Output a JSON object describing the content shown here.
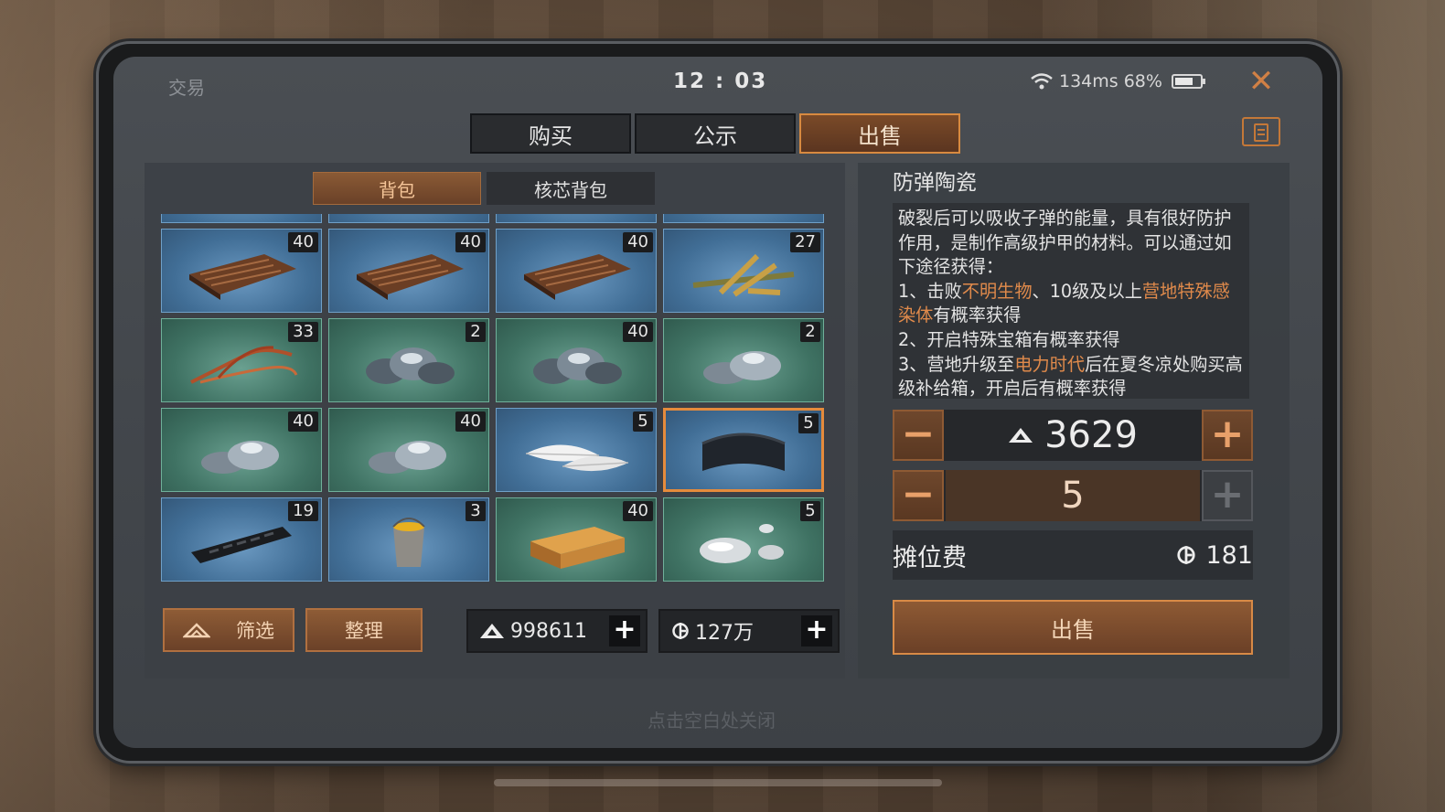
{
  "status_bar": {
    "title": "交易",
    "clock": "12 : 03",
    "network": "134ms 68%"
  },
  "tabs": [
    {
      "label": "购买",
      "active": false
    },
    {
      "label": "公示",
      "active": false
    },
    {
      "label": "出售",
      "active": true
    }
  ],
  "subtabs": [
    {
      "label": "背包",
      "active": true
    },
    {
      "label": "核芯背包",
      "active": false
    }
  ],
  "inventory": [
    {
      "icon": "wood-plank-icon",
      "count": "40",
      "bg": "blue"
    },
    {
      "icon": "wood-plank-icon",
      "count": "40",
      "bg": "blue"
    },
    {
      "icon": "wood-plank-icon",
      "count": "40",
      "bg": "blue"
    },
    {
      "icon": "branch-icon",
      "count": "27",
      "bg": "blue"
    },
    {
      "icon": "vine-icon",
      "count": "33",
      "bg": "green"
    },
    {
      "icon": "ore-icon",
      "count": "2",
      "bg": "green"
    },
    {
      "icon": "ore-icon",
      "count": "40",
      "bg": "green"
    },
    {
      "icon": "ore-icon",
      "count": "2",
      "bg": "green"
    },
    {
      "icon": "ore-icon",
      "count": "40",
      "bg": "green"
    },
    {
      "icon": "ore-icon",
      "count": "40",
      "bg": "green"
    },
    {
      "icon": "feather-icon",
      "count": "5",
      "bg": "blue"
    },
    {
      "icon": "ceramic-plate-icon",
      "count": "5",
      "bg": "blue",
      "selected": true
    },
    {
      "icon": "rifle-handguard-icon",
      "count": "19",
      "bg": "blue"
    },
    {
      "icon": "paint-bucket-icon",
      "count": "3",
      "bg": "blue"
    },
    {
      "icon": "wood-block-icon",
      "count": "40",
      "bg": "green"
    },
    {
      "icon": "mercury-icon",
      "count": "5",
      "bg": "green"
    }
  ],
  "buttons": {
    "filter": "筛选",
    "sort": "整理",
    "sell": "出售"
  },
  "currency": {
    "crystals": "998611",
    "coins": "127万"
  },
  "detail": {
    "name": "防弹陶瓷",
    "desc": {
      "p1": "破裂后可以吸收子弹的能量，具有很好防护作用，是制作高级护甲的材料。可以通过如下途径获得：",
      "l1a": "1、击败",
      "l1b": "不明生物",
      "l1c": "、10级及以上",
      "l1d": "营地特殊感染体",
      "l1e": "有概率获得",
      "l2": "2、开启特殊宝箱有概率获得",
      "l3a": "3、营地升级至",
      "l3b": "电力时代",
      "l3c": "后在夏冬凉处购买高级补给箱，开启后有概率获得"
    },
    "price": "3629",
    "quantity": "5",
    "fee_label": "摊位费",
    "fee_value": "181"
  },
  "hint": "点击空白处关闭",
  "colors": {
    "accent": "#d88a40",
    "highlight_text": "#e08a4b",
    "blue_slot": "#4a7aa3",
    "green_slot": "#427866"
  }
}
